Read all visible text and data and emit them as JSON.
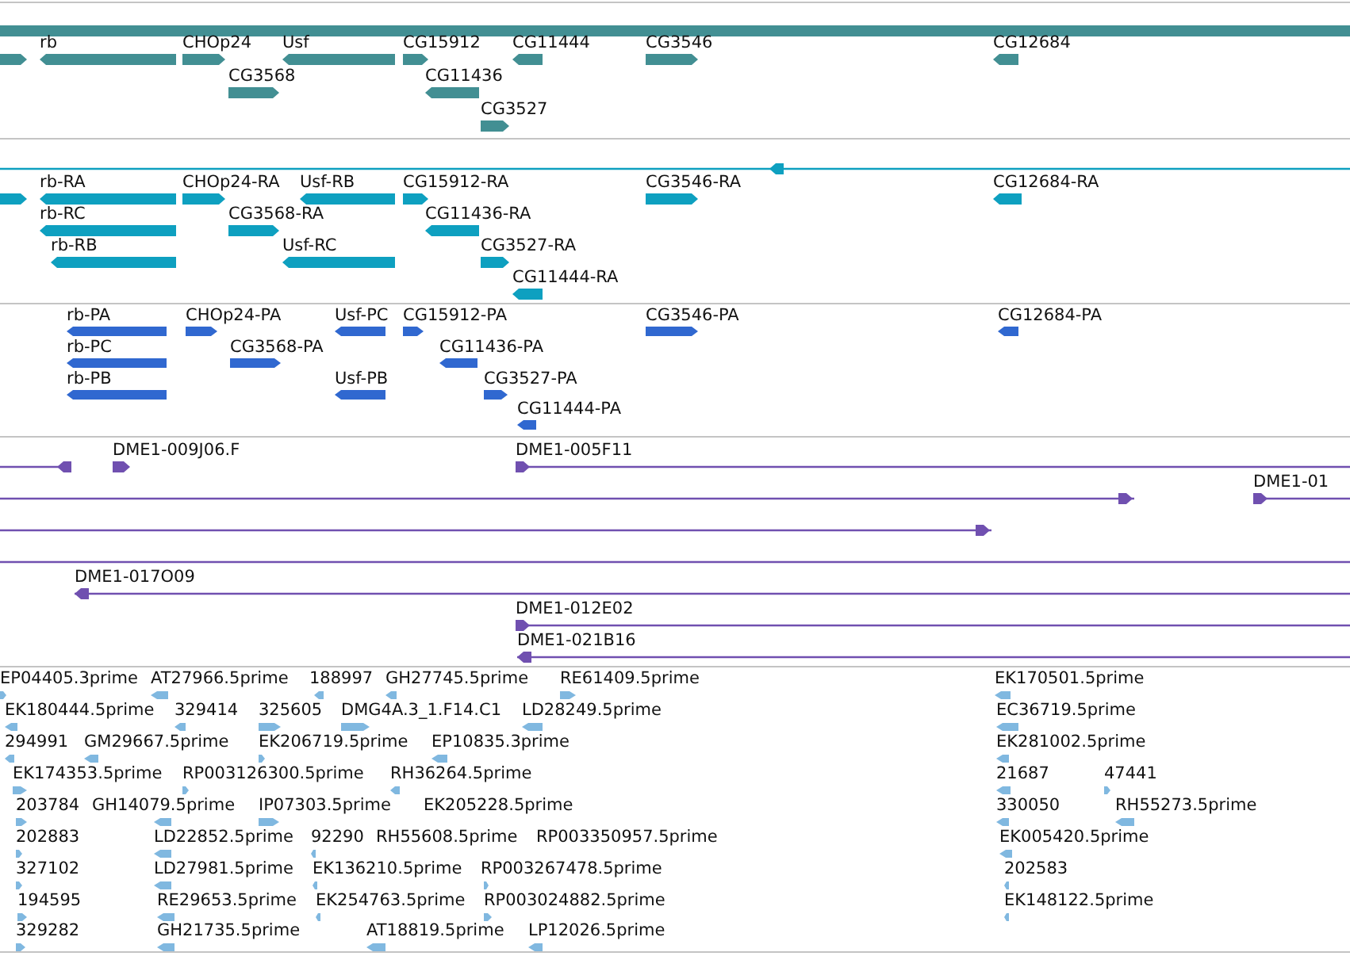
{
  "tracks": [
    {
      "kind": "gene",
      "color": "#428f93",
      "features": [
        {
          "kind": "bar"
        },
        {
          "kind": "forward-bar"
        },
        {
          "label": "rb",
          "kind": "reverse-bar"
        },
        {
          "label": "CHOp24",
          "kind": "forward-bar"
        },
        {
          "label": "Usf",
          "kind": "reverse-bar"
        },
        {
          "label": "CG15912",
          "kind": "forward-bar"
        },
        {
          "label": "CG11444",
          "kind": "reverse-bar"
        },
        {
          "label": "CG3546",
          "kind": "forward-bar"
        },
        {
          "label": "CG12684",
          "kind": "reverse-bar"
        },
        {
          "label": "CG3568",
          "kind": "forward-bar"
        },
        {
          "label": "CG11436",
          "kind": "reverse-bar"
        },
        {
          "label": "CG3527",
          "kind": "forward-bar"
        }
      ]
    },
    {
      "kind": "transcript",
      "color": "#0ea0c0",
      "features": [
        {
          "kind": "reverse-line"
        },
        {
          "kind": "forward-bar"
        },
        {
          "label": "rb-RA",
          "kind": "reverse-bar"
        },
        {
          "label": "CHOp24-RA",
          "kind": "forward-bar"
        },
        {
          "label": "Usf-RB",
          "kind": "reverse-bar"
        },
        {
          "label": "CG15912-RA",
          "kind": "forward-bar"
        },
        {
          "label": "CG3546-RA",
          "kind": "forward-bar"
        },
        {
          "label": "CG12684-RA",
          "kind": "reverse-bar"
        },
        {
          "label": "rb-RC",
          "kind": "reverse-bar"
        },
        {
          "label": "CG3568-RA",
          "kind": "forward-bar"
        },
        {
          "label": "CG11436-RA",
          "kind": "reverse-bar"
        },
        {
          "label": "rb-RB",
          "kind": "reverse-bar"
        },
        {
          "label": "Usf-RC",
          "kind": "reverse-bar"
        },
        {
          "label": "CG3527-RA",
          "kind": "forward-bar"
        },
        {
          "label": "CG11444-RA",
          "kind": "reverse-bar"
        }
      ]
    },
    {
      "kind": "protein",
      "color": "#3068d0",
      "features": [
        {
          "label": "rb-PA",
          "kind": "reverse-bar"
        },
        {
          "label": "CHOp24-PA",
          "kind": "forward-bar"
        },
        {
          "label": "Usf-PC",
          "kind": "reverse-bar"
        },
        {
          "label": "CG15912-PA",
          "kind": "forward-bar"
        },
        {
          "label": "CG3546-PA",
          "kind": "forward-bar"
        },
        {
          "label": "CG12684-PA",
          "kind": "reverse-bar"
        },
        {
          "label": "rb-PC",
          "kind": "reverse-bar"
        },
        {
          "label": "CG3568-PA",
          "kind": "forward-bar"
        },
        {
          "label": "CG11436-PA",
          "kind": "reverse-bar"
        },
        {
          "label": "rb-PB",
          "kind": "reverse-bar"
        },
        {
          "label": "Usf-PB",
          "kind": "reverse-bar"
        },
        {
          "label": "CG3527-PA",
          "kind": "forward-bar"
        },
        {
          "label": "CG11444-PA",
          "kind": "reverse-bar"
        }
      ]
    },
    {
      "kind": "clone",
      "color": "#7050b0",
      "features": [
        {
          "kind": "reverse-line"
        },
        {
          "label": "DME1-009J06.F",
          "kind": "forward-bar"
        },
        {
          "label": "DME1-005F11",
          "kind": "forward-line"
        },
        {
          "kind": "forward-line"
        },
        {
          "label": "DME1-01",
          "kind": "forward-line"
        },
        {
          "kind": "forward-line"
        },
        {
          "kind": "line"
        },
        {
          "label": "DME1-017O09",
          "kind": "reverse-line"
        },
        {
          "label": "DME1-012E02",
          "kind": "forward-line"
        },
        {
          "label": "DME1-021B16",
          "kind": "reverse-line"
        }
      ]
    },
    {
      "kind": "est",
      "color": "#80b8e0",
      "features": [
        {
          "label": "EP04405.3prime",
          "kind": "forward-bar"
        },
        {
          "label": "AT27966.5prime",
          "kind": "reverse-bar"
        },
        {
          "label": "188997",
          "kind": "reverse-bar"
        },
        {
          "label": "GH27745.5prime",
          "kind": "reverse-bar"
        },
        {
          "label": "RE61409.5prime",
          "kind": "forward-bar"
        },
        {
          "label": "EK170501.5prime",
          "kind": "reverse-bar"
        },
        {
          "label": "EK180444.5prime",
          "kind": "reverse-bar"
        },
        {
          "label": "329414",
          "kind": "reverse-bar"
        },
        {
          "label": "325605",
          "kind": "forward-bar"
        },
        {
          "label": "DMG4A.3_1.F14.C1",
          "kind": "forward-bar"
        },
        {
          "label": "LD28249.5prime",
          "kind": "reverse-bar"
        },
        {
          "label": "EC36719.5prime",
          "kind": "reverse-bar"
        },
        {
          "label": "294991",
          "kind": "reverse-bar"
        },
        {
          "label": "GM29667.5prime",
          "kind": "reverse-bar"
        },
        {
          "label": "EK206719.5prime",
          "kind": "forward-bar"
        },
        {
          "label": "EP10835.3prime",
          "kind": "reverse-bar"
        },
        {
          "label": "EK281002.5prime",
          "kind": "reverse-bar"
        },
        {
          "label": "EK174353.5prime",
          "kind": "forward-bar"
        },
        {
          "label": "RP003126300.5prime",
          "kind": "forward-bar"
        },
        {
          "label": "RH36264.5prime",
          "kind": "reverse-bar"
        },
        {
          "label": "21687",
          "kind": "reverse-bar"
        },
        {
          "label": "47441",
          "kind": "forward-bar"
        },
        {
          "label": "203784",
          "kind": "forward-bar"
        },
        {
          "label": "GH14079.5prime",
          "kind": "reverse-bar"
        },
        {
          "label": "IP07303.5prime",
          "kind": "forward-bar"
        },
        {
          "label": "EK205228.5prime"
        },
        {
          "label": "330050",
          "kind": "reverse-bar"
        },
        {
          "label": "RH55273.5prime",
          "kind": "reverse-bar"
        },
        {
          "label": "202883",
          "kind": "forward-bar"
        },
        {
          "label": "LD22852.5prime",
          "kind": "reverse-bar"
        },
        {
          "label": "92290",
          "kind": "reverse-bar"
        },
        {
          "label": "RH55608.5prime"
        },
        {
          "label": "RP003350957.5prime"
        },
        {
          "label": "EK005420.5prime",
          "kind": "reverse-bar"
        },
        {
          "label": "327102",
          "kind": "forward-bar"
        },
        {
          "label": "LD27981.5prime",
          "kind": "reverse-bar"
        },
        {
          "label": "EK136210.5prime",
          "kind": "reverse-bar"
        },
        {
          "label": "RP003267478.5prime",
          "kind": "forward-bar"
        },
        {
          "label": "202583",
          "kind": "reverse-bar"
        },
        {
          "label": "194595",
          "kind": "forward-bar"
        },
        {
          "label": "RE29653.5prime",
          "kind": "reverse-bar"
        },
        {
          "label": "EK254763.5prime",
          "kind": "reverse-bar"
        },
        {
          "label": "RP003024882.5prime",
          "kind": "forward-bar"
        },
        {
          "label": "EK148122.5prime",
          "kind": "reverse-bar"
        },
        {
          "label": "329282",
          "kind": "forward-bar"
        },
        {
          "label": "GH21735.5prime",
          "kind": "reverse-bar"
        },
        {
          "label": "AT18819.5prime",
          "kind": "reverse-bar"
        },
        {
          "label": "LP12026.5prime",
          "kind": "reverse-bar"
        }
      ]
    }
  ]
}
